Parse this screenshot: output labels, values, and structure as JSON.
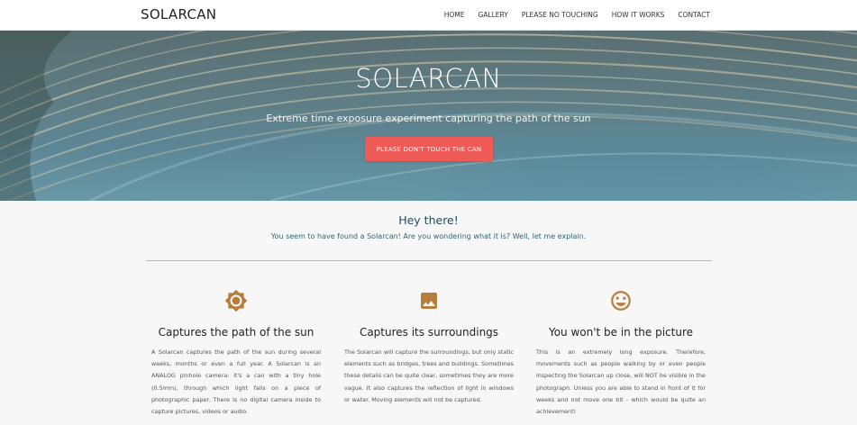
{
  "navbar": {
    "brand": "SOLARCAN",
    "links": [
      "HOME",
      "GALLERY",
      "PLEASE NO TOUCHING",
      "HOW IT WORKS",
      "CONTACT"
    ]
  },
  "hero": {
    "title": "SOLARCAN",
    "subtitle": "Extreme time exposure experiment capturing the path of the sun",
    "button_label": "PLEASE DON'T TOUCH THE CAN"
  },
  "intro": {
    "title": "Hey there!",
    "text": "You seem to have found a Solarcan! Are you wondering what it is? Well, let me explain."
  },
  "features": [
    {
      "icon": "sun-icon",
      "title": "Captures the path of the sun",
      "text": "A Solarcan captures the path of the sun during several weeks, months or even a full year. A Solarcan is an ANALOG pinhole camera: it's a can with a tiny hole (0.5mm), through which light falls on a piece of photographic paper. There is no digital camera inside to capture pictures, videos or audio."
    },
    {
      "icon": "image-icon",
      "title": "Captures its surroundings",
      "text": "The Solarcan will capture the surroundings, but only static elements such as bridges, trees and buildings. Sometimes these details can be quite clear, sometimes they are more vague. It also captures the reflection of light in windows or water. Moving elements will not be captured."
    },
    {
      "icon": "smiley-icon",
      "title": "You won't be in the picture",
      "text": "This is an extremely long exposure. Therefore, movements such as people walking by or even people inspecting the Solarcan up close, will NOT be visible in the photograph. Unless you are able to stand in front of it for weeks and not move one bit - which would be quite an achievement!"
    }
  ],
  "colors": {
    "accent_button": "#ee5a55",
    "icon": "#b87d3b",
    "intro_text": "#2e6375"
  }
}
